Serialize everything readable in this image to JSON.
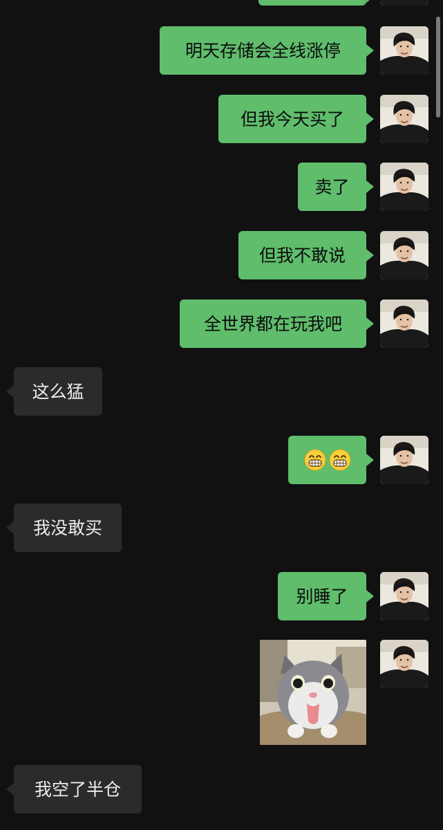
{
  "messages": [
    {
      "text": ""
    },
    {
      "text": "明天存储会全线涨停"
    },
    {
      "text": "但我今天买了"
    },
    {
      "text": "卖了"
    },
    {
      "text": "但我不敢说"
    },
    {
      "text": "全世界都在玩我吧"
    },
    {
      "text": "这么猛"
    },
    {
      "text": "grinning-emoji x2"
    },
    {
      "text": "我没敢买"
    },
    {
      "text": "别睡了"
    },
    {
      "text": "cat-sticker"
    },
    {
      "text": "我空了半仓"
    }
  ],
  "colors": {
    "background": "#111111",
    "outgoing_bubble": "#5fbd6c",
    "incoming_bubble": "#2b2b2b",
    "incoming_text": "#ededed",
    "outgoing_text": "#0c0c0c"
  },
  "icons": {
    "avatar": "user-avatar-photo",
    "emoji": "grinning-face-icon",
    "sticker": "cat-sticker-image"
  }
}
